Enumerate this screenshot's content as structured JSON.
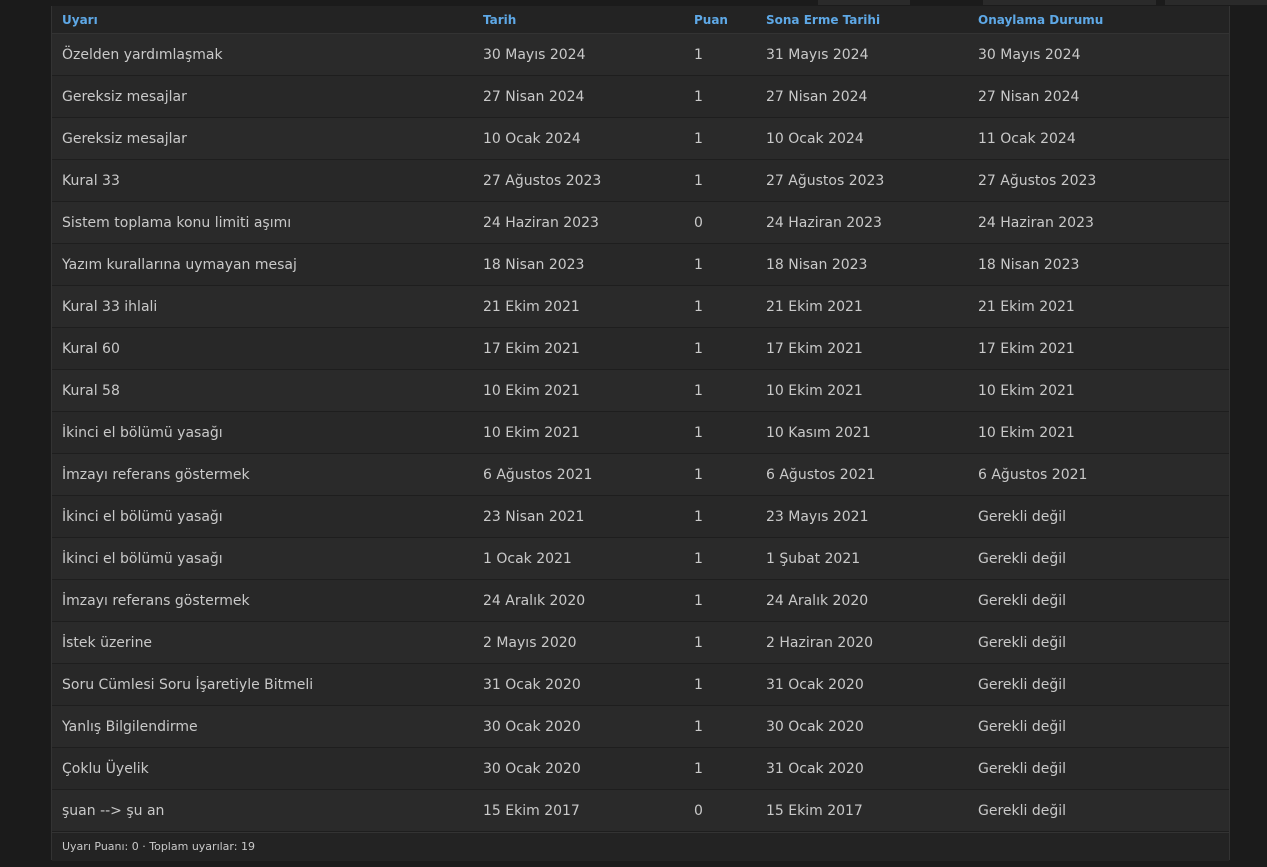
{
  "table": {
    "headers": {
      "warning": "Uyarı",
      "date": "Tarih",
      "points": "Puan",
      "expiry": "Sona Erme Tarihi",
      "ack": "Onaylama Durumu"
    },
    "rows": [
      {
        "warning": "Özelden yardımlaşmak",
        "date": "30 Mayıs 2024",
        "points": "1",
        "expiry": "31 Mayıs 2024",
        "ack": "30 Mayıs 2024"
      },
      {
        "warning": "Gereksiz mesajlar",
        "date": "27 Nisan 2024",
        "points": "1",
        "expiry": "27 Nisan 2024",
        "ack": "27 Nisan 2024"
      },
      {
        "warning": "Gereksiz mesajlar",
        "date": "10 Ocak 2024",
        "points": "1",
        "expiry": "10 Ocak 2024",
        "ack": "11 Ocak 2024"
      },
      {
        "warning": "Kural 33",
        "date": "27 Ağustos 2023",
        "points": "1",
        "expiry": "27 Ağustos 2023",
        "ack": "27 Ağustos 2023"
      },
      {
        "warning": "Sistem toplama konu limiti aşımı",
        "date": "24 Haziran 2023",
        "points": "0",
        "expiry": "24 Haziran 2023",
        "ack": "24 Haziran 2023"
      },
      {
        "warning": "Yazım kurallarına uymayan mesaj",
        "date": "18 Nisan 2023",
        "points": "1",
        "expiry": "18 Nisan 2023",
        "ack": "18 Nisan 2023"
      },
      {
        "warning": "Kural 33 ihlali",
        "date": "21 Ekim 2021",
        "points": "1",
        "expiry": "21 Ekim 2021",
        "ack": "21 Ekim 2021"
      },
      {
        "warning": "Kural 60",
        "date": "17 Ekim 2021",
        "points": "1",
        "expiry": "17 Ekim 2021",
        "ack": "17 Ekim 2021"
      },
      {
        "warning": "Kural 58",
        "date": "10 Ekim 2021",
        "points": "1",
        "expiry": "10 Ekim 2021",
        "ack": "10 Ekim 2021"
      },
      {
        "warning": "İkinci el bölümü yasağı",
        "date": "10 Ekim 2021",
        "points": "1",
        "expiry": "10 Kasım 2021",
        "ack": "10 Ekim 2021"
      },
      {
        "warning": "İmzayı referans göstermek",
        "date": "6 Ağustos 2021",
        "points": "1",
        "expiry": "6 Ağustos 2021",
        "ack": "6 Ağustos 2021"
      },
      {
        "warning": "İkinci el bölümü yasağı",
        "date": "23 Nisan 2021",
        "points": "1",
        "expiry": "23 Mayıs 2021",
        "ack": "Gerekli değil"
      },
      {
        "warning": "İkinci el bölümü yasağı",
        "date": "1 Ocak 2021",
        "points": "1",
        "expiry": "1 Şubat 2021",
        "ack": "Gerekli değil"
      },
      {
        "warning": "İmzayı referans göstermek",
        "date": "24 Aralık 2020",
        "points": "1",
        "expiry": "24 Aralık 2020",
        "ack": "Gerekli değil"
      },
      {
        "warning": "İstek üzerine",
        "date": "2 Mayıs 2020",
        "points": "1",
        "expiry": "2 Haziran 2020",
        "ack": "Gerekli değil"
      },
      {
        "warning": "Soru Cümlesi Soru İşaretiyle Bitmeli",
        "date": "31 Ocak 2020",
        "points": "1",
        "expiry": "31 Ocak 2020",
        "ack": "Gerekli değil"
      },
      {
        "warning": "Yanlış Bilgilendirme",
        "date": "30 Ocak 2020",
        "points": "1",
        "expiry": "30 Ocak 2020",
        "ack": "Gerekli değil"
      },
      {
        "warning": "Çoklu Üyelik",
        "date": "30 Ocak 2020",
        "points": "1",
        "expiry": "31 Ocak 2020",
        "ack": "Gerekli değil"
      },
      {
        "warning": "şuan --> şu an",
        "date": "15 Ekim 2017",
        "points": "0",
        "expiry": "15 Ekim 2017",
        "ack": "Gerekli değil"
      }
    ]
  },
  "footer": {
    "summary": "Uyarı Puanı: 0 · Toplam uyarılar: 19"
  },
  "colors": {
    "header_text": "#5ea8e6",
    "cell_text": "#c9c9c9",
    "background": "#1b1b1b",
    "panel": "#272727"
  }
}
